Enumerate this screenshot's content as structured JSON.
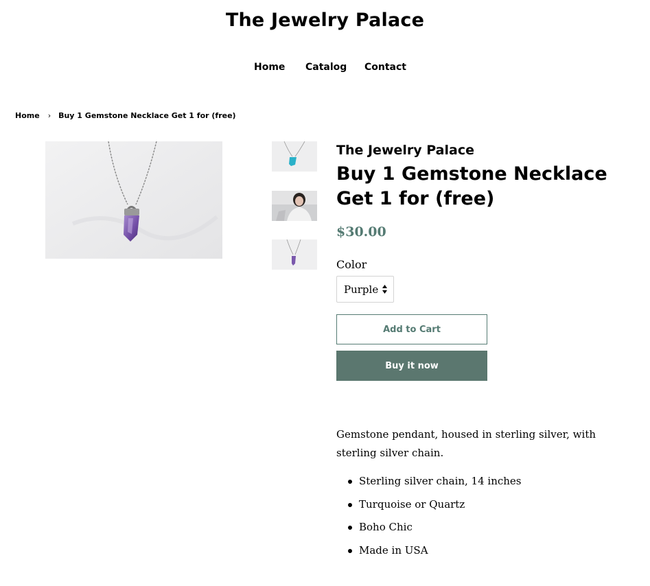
{
  "site": {
    "title": "The Jewelry Palace"
  },
  "nav": {
    "items": [
      "Home",
      "Catalog",
      "Contact"
    ]
  },
  "breadcrumb": {
    "home": "Home",
    "separator": "›",
    "current": "Buy 1 Gemstone Necklace Get 1 for (free)"
  },
  "product": {
    "vendor": "The Jewelry Palace",
    "title": "Buy 1 Gemstone Necklace Get 1 for (free)",
    "price": "$30.00",
    "color_label": "Color",
    "color_selected": "Purple",
    "add_to_cart": "Add to Cart",
    "buy_now": "Buy it now",
    "description": "Gemstone pendant, housed in sterling silver, with sterling silver chain.",
    "features": [
      "Sterling silver chain, 14 inches",
      "Turquoise or Quartz",
      "Boho Chic",
      "Made in USA"
    ]
  },
  "colors": {
    "accent": "#557b73",
    "buy_button": "#5b776f"
  },
  "images": {
    "main": "amethyst-pendant-necklace-photo",
    "thumbs": [
      "turquoise-pendant-thumb",
      "model-wearing-necklace-thumb",
      "amethyst-pendant-thumb"
    ]
  }
}
